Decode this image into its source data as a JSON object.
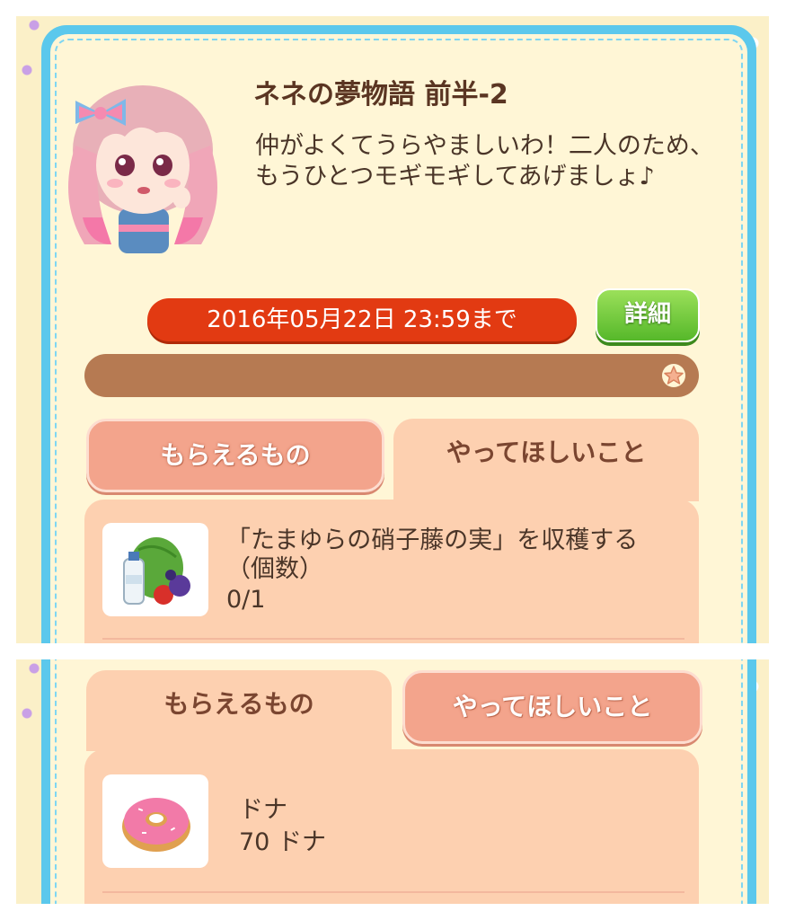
{
  "mission": {
    "title": "ネネの夢物語 前半-2",
    "description": "仲がよくてうらやましいわ！二人のため、もうひとつモギモギしてあげましょ♪",
    "deadline": "2016年05月22日 23:59まで",
    "detail_label": "詳細",
    "progress": 0
  },
  "tabs": {
    "rewards_label": "もらえるもの",
    "requests_label": "やってほしいこと"
  },
  "requests": [
    {
      "icon": "vegetables-milk-icon",
      "text": "「たまゆらの硝子藤の実」を収穫する（個数）",
      "count": "0/1"
    }
  ],
  "rewards": [
    {
      "icon": "donut-icon",
      "name": "ドナ",
      "amount": "70 ドナ"
    }
  ],
  "colors": {
    "frame": "#5bc8ec",
    "card": "#fff6d6",
    "deadline": "#e23a12",
    "detail_button": "#56b82a",
    "progress_track": "#b67a52",
    "tab_active": "#fdd0b0",
    "tab_inactive": "#f3a48c"
  }
}
